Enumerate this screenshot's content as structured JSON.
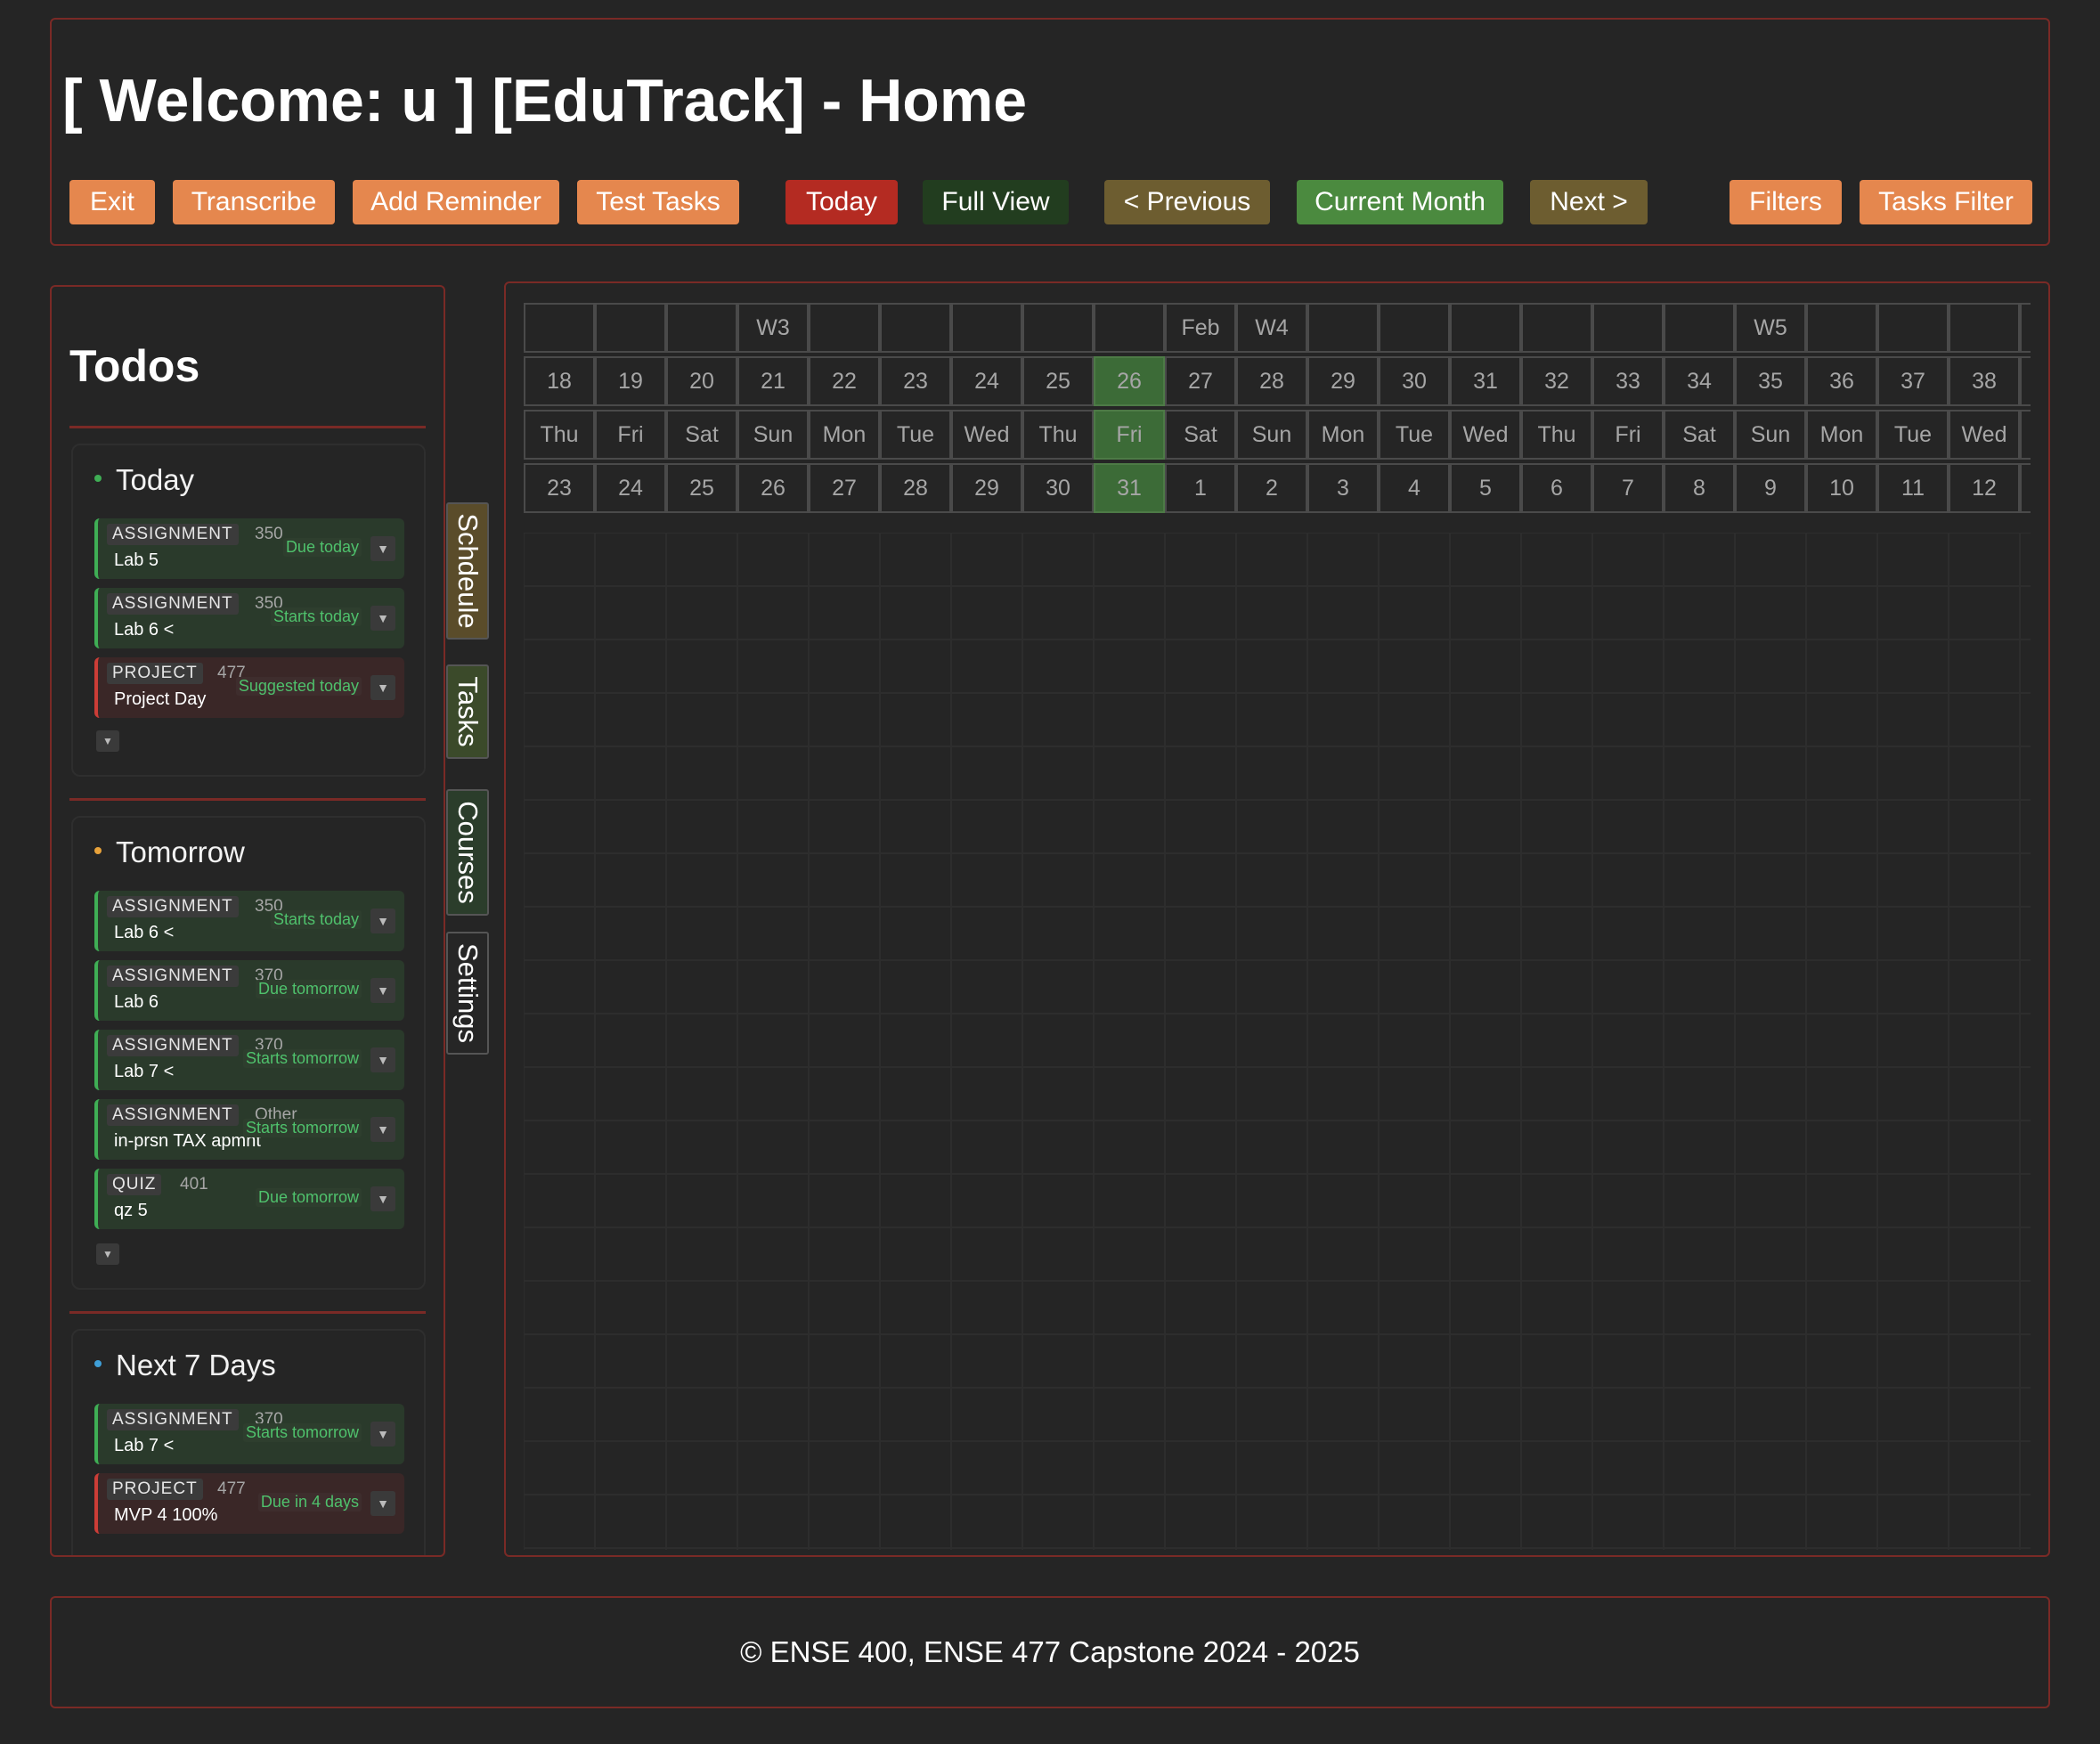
{
  "header": {
    "title": "[ Welcome: u ] [EduTrack] - Home",
    "buttons": {
      "exit": "Exit",
      "transcribe": "Transcribe",
      "add_reminder": "Add Reminder",
      "test_tasks": "Test Tasks",
      "today": "Today",
      "full_view": "Full View",
      "previous": "< Previous",
      "current_month": "Current Month",
      "next": "Next >",
      "filters": "Filters",
      "tasks_filter": "Tasks Filter"
    }
  },
  "colors": {
    "panel_border": "#7a2a26",
    "orange_button": "#e5874e",
    "today_button": "#b42b22",
    "full_view_button": "#223d1f",
    "nav_button": "#6d5d30",
    "current_month_button": "#4b8a3f",
    "highlight_cell": "#3c6b37",
    "status_green": "#4fc16c",
    "today_dot": "#3fae55",
    "tomorrow_dot": "#e8a23a",
    "next7_dot": "#3f9fd8"
  },
  "todos": {
    "title": "Todos",
    "sections": {
      "today": {
        "title": "Today",
        "items": [
          {
            "type": "ASSIGNMENT",
            "course": "350",
            "name": "Lab 5",
            "status": "Due today"
          },
          {
            "type": "ASSIGNMENT",
            "course": "350",
            "name": "Lab 6 <",
            "status": "Starts today"
          },
          {
            "type": "PROJECT",
            "course": "477",
            "name": "Project Day",
            "status": "Suggested today"
          }
        ]
      },
      "tomorrow": {
        "title": "Tomorrow",
        "items": [
          {
            "type": "ASSIGNMENT",
            "course": "350",
            "name": "Lab 6 <",
            "status": "Starts today"
          },
          {
            "type": "ASSIGNMENT",
            "course": "370",
            "name": "Lab 6",
            "status": "Due tomorrow"
          },
          {
            "type": "ASSIGNMENT",
            "course": "370",
            "name": "Lab 7 <",
            "status": "Starts tomorrow"
          },
          {
            "type": "ASSIGNMENT",
            "course": "Other",
            "name": "in-prsn TAX apmnt",
            "status": "Starts tomorrow"
          },
          {
            "type": "QUIZ",
            "course": "401",
            "name": "qz 5",
            "status": "Due tomorrow"
          }
        ]
      },
      "next7": {
        "title": "Next 7 Days",
        "items": [
          {
            "type": "ASSIGNMENT",
            "course": "370",
            "name": "Lab 7 <",
            "status": "Starts tomorrow"
          },
          {
            "type": "PROJECT",
            "course": "477",
            "name": "MVP 4 100%",
            "status": "Due in 4 days"
          }
        ]
      }
    }
  },
  "side_tabs": [
    "Schdeule",
    "Tasks",
    "Courses",
    "Settings"
  ],
  "calendar": {
    "week_row": [
      "",
      "",
      "",
      "W3",
      "",
      "",
      "",
      "",
      "",
      "Feb",
      "W4",
      "",
      "",
      "",
      "",
      "",
      "",
      "W5",
      "",
      "",
      "",
      ""
    ],
    "day_number_row": [
      "18",
      "19",
      "20",
      "21",
      "22",
      "23",
      "24",
      "25",
      "26",
      "27",
      "28",
      "29",
      "30",
      "31",
      "32",
      "33",
      "34",
      "35",
      "36",
      "37",
      "38",
      ""
    ],
    "weekday_row": [
      "Thu",
      "Fri",
      "Sat",
      "Sun",
      "Mon",
      "Tue",
      "Wed",
      "Thu",
      "Fri",
      "Sat",
      "Sun",
      "Mon",
      "Tue",
      "Wed",
      "Thu",
      "Fri",
      "Sat",
      "Sun",
      "Mon",
      "Tue",
      "Wed",
      ""
    ],
    "date_row": [
      "23",
      "24",
      "25",
      "26",
      "27",
      "28",
      "29",
      "30",
      "31",
      "1",
      "2",
      "3",
      "4",
      "5",
      "6",
      "7",
      "8",
      "9",
      "10",
      "11",
      "12",
      ""
    ],
    "highlight_column": 8
  },
  "footer": {
    "text": "© ENSE 400, ENSE 477 Capstone 2024 - 2025"
  }
}
